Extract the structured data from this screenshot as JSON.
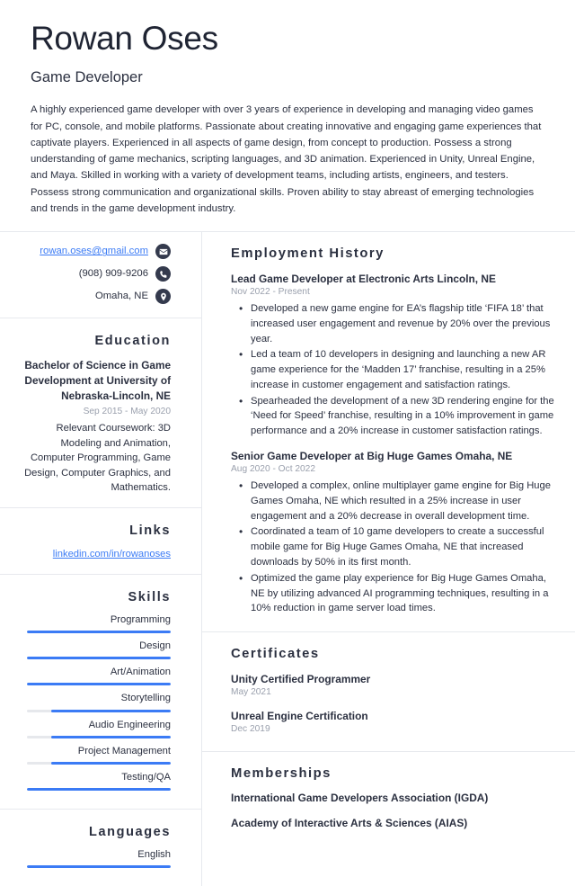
{
  "header": {
    "name": "Rowan Oses",
    "job_title": "Game Developer",
    "summary": "A highly experienced game developer with over 3 years of experience in developing and managing video games for PC, console, and mobile platforms. Passionate about creating innovative and engaging game experiences that captivate players. Experienced in all aspects of game design, from concept to production. Possess a strong understanding of game mechanics, scripting languages, and 3D animation. Experienced in Unity, Unreal Engine, and Maya. Skilled in working with a variety of development teams, including artists, engineers, and testers. Possess strong communication and organizational skills. Proven ability to stay abreast of emerging technologies and trends in the game development industry."
  },
  "colors": {
    "accent": "#3b7bf5",
    "text": "#2b3040",
    "muted": "#9aa0ad",
    "icon_bg": "#343a4d",
    "divider": "#e7e9ee",
    "bar_track": "#e6e8ec"
  },
  "sidebar": {
    "contact": [
      {
        "text": "rowan.oses@gmail.com",
        "icon": "envelope-icon",
        "is_link": true
      },
      {
        "text": "(908) 909-9206",
        "icon": "phone-icon",
        "is_link": false
      },
      {
        "text": "Omaha, NE",
        "icon": "location-pin-icon",
        "is_link": false
      }
    ],
    "education": {
      "heading": "Education",
      "degree": "Bachelor of Science in Game Development at University of Nebraska-Lincoln, NE",
      "dates": "Sep 2015 - May 2020",
      "description": "Relevant Coursework: 3D Modeling and Animation, Computer Programming, Game Design, Computer Graphics, and Mathematics."
    },
    "links": {
      "heading": "Links",
      "items": [
        {
          "text": "linkedin.com/in/rowanoses"
        }
      ]
    },
    "skills": {
      "heading": "Skills",
      "items": [
        {
          "label": "Programming",
          "level": 100
        },
        {
          "label": "Design",
          "level": 100
        },
        {
          "label": "Art/Animation",
          "level": 100
        },
        {
          "label": "Storytelling",
          "level": 83
        },
        {
          "label": "Audio Engineering",
          "level": 83
        },
        {
          "label": "Project Management",
          "level": 83
        },
        {
          "label": "Testing/QA",
          "level": 100
        }
      ]
    },
    "languages": {
      "heading": "Languages",
      "items": [
        {
          "label": "English",
          "level": 100
        }
      ]
    }
  },
  "main": {
    "employment": {
      "heading": "Employment History",
      "jobs": [
        {
          "title": "Lead Game Developer at Electronic Arts Lincoln, NE",
          "dates": "Nov 2022 - Present",
          "bullets": [
            "Developed a new game engine for EA’s flagship title ‘FIFA 18’ that increased user engagement and revenue by 20% over the previous year.",
            "Led a team of 10 developers in designing and launching a new AR game experience for the ‘Madden 17’ franchise, resulting in a 25% increase in customer engagement and satisfaction ratings.",
            "Spearheaded the development of a new 3D rendering engine for the ‘Need for Speed’ franchise, resulting in a 10% improvement in game performance and a 20% increase in customer satisfaction ratings."
          ]
        },
        {
          "title": "Senior Game Developer at Big Huge Games Omaha, NE",
          "dates": "Aug 2020 - Oct 2022",
          "bullets": [
            "Developed a complex, online multiplayer game engine for Big Huge Games Omaha, NE which resulted in a 25% increase in user engagement and a 20% decrease in overall development time.",
            "Coordinated a team of 10 game developers to create a successful mobile game for Big Huge Games Omaha, NE that increased downloads by 50% in its first month.",
            "Optimized the game play experience for Big Huge Games Omaha, NE by utilizing advanced AI programming techniques, resulting in a 10% reduction in game server load times."
          ]
        }
      ]
    },
    "certificates": {
      "heading": "Certificates",
      "items": [
        {
          "title": "Unity Certified Programmer",
          "date": "May 2021"
        },
        {
          "title": "Unreal Engine Certification",
          "date": "Dec 2019"
        }
      ]
    },
    "memberships": {
      "heading": "Memberships",
      "items": [
        {
          "title": "International Game Developers Association (IGDA)"
        },
        {
          "title": "Academy of Interactive Arts & Sciences (AIAS)"
        }
      ]
    }
  }
}
